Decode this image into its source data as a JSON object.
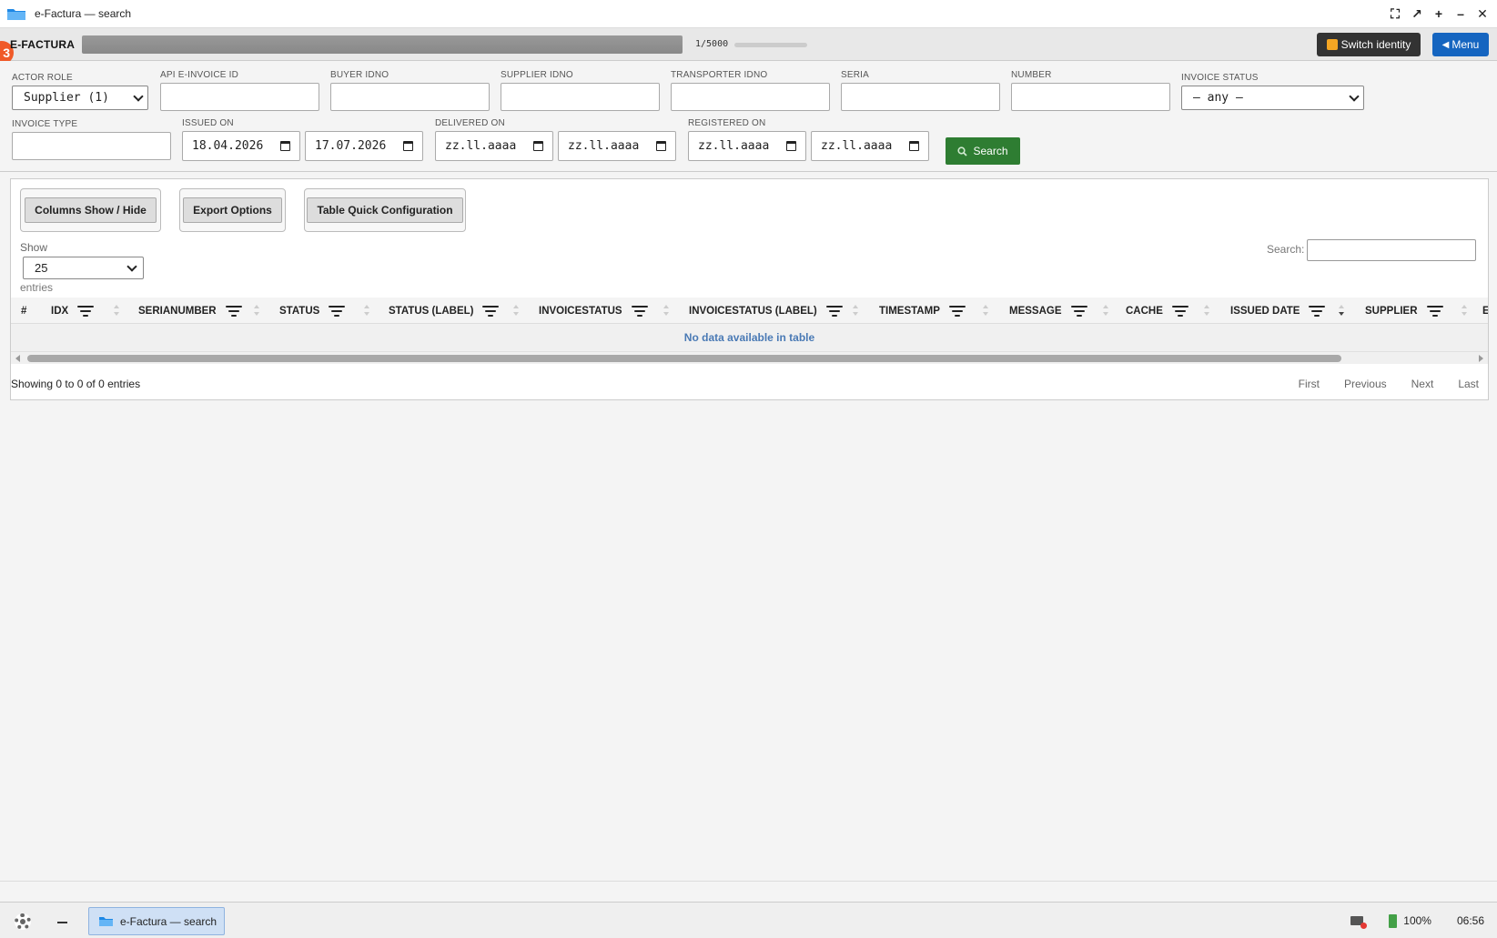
{
  "window": {
    "title": "e-Factura — search"
  },
  "appbar": {
    "badge": "3",
    "brand": "E-FACTURA",
    "counter": "1/5000",
    "switch_identity": "Switch identity",
    "menu": "Menu",
    "menu_arrow": "◀"
  },
  "filters": {
    "actor_role": {
      "label": "ACTOR ROLE",
      "value": "Supplier (1)"
    },
    "api_id": {
      "label": "API E-INVOICE ID"
    },
    "buyer_idno": {
      "label": "BUYER IDNO"
    },
    "supplier_idno": {
      "label": "SUPPLIER IDNO"
    },
    "transporter_idno": {
      "label": "TRANSPORTER IDNO"
    },
    "seria": {
      "label": "SERIA"
    },
    "number": {
      "label": "NUMBER"
    },
    "invoice_status": {
      "label": "INVOICE STATUS",
      "value": "— any —"
    },
    "invoice_type": {
      "label": "INVOICE TYPE"
    },
    "issued_on": {
      "label": "ISSUED ON",
      "from": "18.04.2026",
      "to": "17.07.2026"
    },
    "delivered_on": {
      "label": "DELIVERED ON",
      "from": "zz.ll.aaaa",
      "to": "zz.ll.aaaa"
    },
    "registered_on": {
      "label": "REGISTERED ON",
      "from": "zz.ll.aaaa",
      "to": "zz.ll.aaaa"
    },
    "search_button": "Search"
  },
  "table_controls": {
    "columns_button": "Columns Show / Hide",
    "export_button": "Export Options",
    "quick_config_button": "Table Quick Configuration",
    "show_label": "Show",
    "page_length": "25",
    "entries_label": "entries",
    "search_label": "Search:"
  },
  "table": {
    "columns": [
      "#",
      "IDX",
      "SERIANUMBER",
      "STATUS",
      "STATUS (LABEL)",
      "INVOICESTATUS",
      "INVOICESTATUS (LABEL)",
      "TIMESTAMP",
      "MESSAGE",
      "CACHE",
      "ISSUED DATE",
      "SUPPLIER",
      "E"
    ],
    "empty_message": "No data available in table",
    "info": "Showing 0 to 0 of 0 entries",
    "pager": {
      "first": "First",
      "previous": "Previous",
      "next": "Next",
      "last": "Last"
    }
  },
  "taskbar": {
    "task_label": "e-Factura — search",
    "battery": "100%",
    "clock": "06:56"
  },
  "colors": {
    "search_green": "#2e7d32",
    "menu_blue": "#1565c0",
    "badge_orange": "#f05a28"
  }
}
